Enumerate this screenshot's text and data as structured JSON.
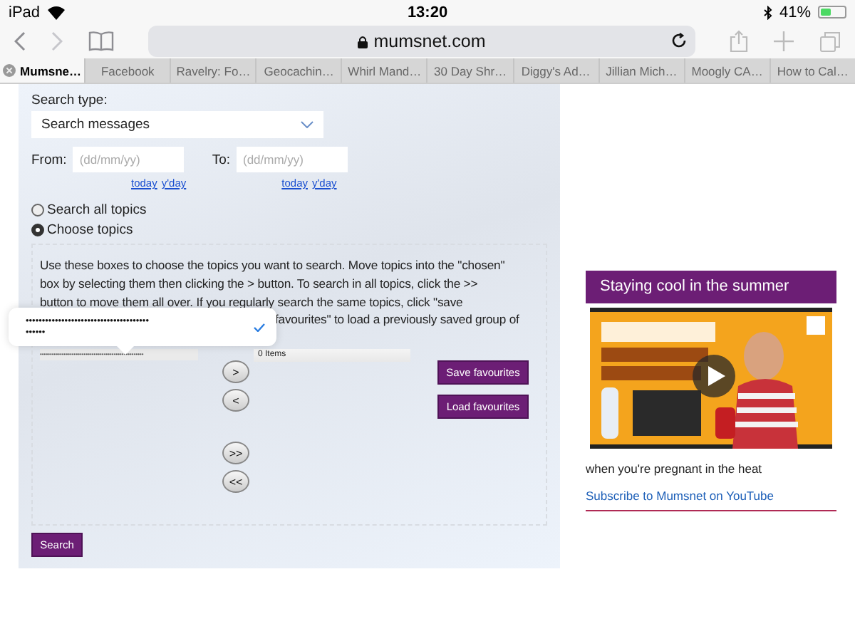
{
  "status_bar": {
    "device": "iPad",
    "time": "13:20",
    "battery": "41%"
  },
  "address_bar": {
    "url": "mumsnet.com"
  },
  "tabs": [
    {
      "label": "Mumsne…",
      "selected": true
    },
    {
      "label": "Facebook",
      "selected": false
    },
    {
      "label": "Ravelry: Fo…",
      "selected": false
    },
    {
      "label": "Geocachin…",
      "selected": false
    },
    {
      "label": "Whirl Mand…",
      "selected": false
    },
    {
      "label": "30 Day Shr…",
      "selected": false
    },
    {
      "label": "Diggy's Ad…",
      "selected": false
    },
    {
      "label": "Jillian Mich…",
      "selected": false
    },
    {
      "label": "Moogly CA…",
      "selected": false
    },
    {
      "label": "How to Cal…",
      "selected": false
    }
  ],
  "search_form": {
    "search_type_label": "Search type:",
    "search_type": "Search messages",
    "from_label": "From:",
    "from": {
      "placeholder": "(dd/mm/yy)"
    },
    "to_label": "To:",
    "to": {
      "placeholder": "(dd/mm/yy)"
    },
    "date_links": [
      [
        "today",
        "y'day"
      ],
      [
        "today",
        "y'day"
      ]
    ],
    "topic_options": [
      {
        "label": "Search all topics",
        "selected": false
      },
      {
        "label": "Choose topics",
        "selected": true
      }
    ],
    "instructions": [
      "Use these boxes to choose the topics you want to search. Move topics into the \"chosen\"",
      "box by selecting them then clicking the > button. To search in all topics, click the >>",
      "button to move them all over. If you regularly search the same topics, click \"save"
    ],
    "instructions_visible_end": "favourites\" to load a previously saved group of",
    "picker_popup": {
      "lines": [
        "••••••••••••••••••••••••••••••••••••••",
        "••••••"
      ],
      "checked": true
    },
    "topics_field": "••••••••••••••••••••••••••••••••••••••••••••••••••••",
    "chosen_field": "0 Items",
    "move_buttons": [
      ">",
      "<",
      ">>",
      "<<"
    ],
    "favourite_buttons": [
      "Save favourites",
      "Load favourites"
    ],
    "search_button": "Search"
  },
  "sidebar_widget": {
    "title": "Staying cool in the summer",
    "caption": "when you're pregnant in the heat",
    "link": "Subscribe to Mumsnet on YouTube"
  }
}
